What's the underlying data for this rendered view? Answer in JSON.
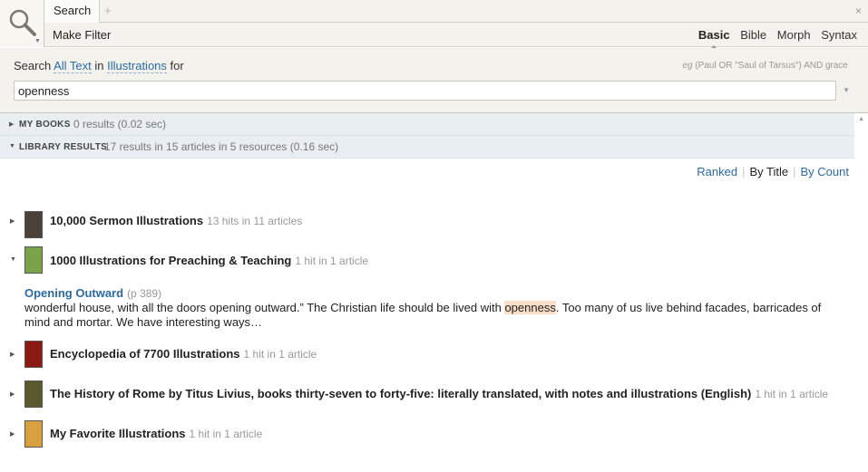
{
  "tab": {
    "label": "Search",
    "add": "+",
    "close": "×"
  },
  "toolbar": {
    "make_filter": "Make Filter",
    "modes": [
      "Basic",
      "Bible",
      "Morph",
      "Syntax"
    ],
    "active_mode": "Basic"
  },
  "query": {
    "prefix": "Search",
    "scope": "All Text",
    "in": "in",
    "collection": "Illustrations",
    "for": "for",
    "hint_eg": "eg",
    "hint_text": "(Paul OR \"Saul of Tarsus\") AND grace",
    "value": "openness"
  },
  "groups": {
    "my_books": {
      "title": "MY BOOKS",
      "summary": "0 results (0.02 sec)"
    },
    "library": {
      "title": "LIBRARY RESULTS",
      "summary": "17 results in 15 articles in 5 resources (0.16 sec)"
    }
  },
  "sort": {
    "ranked": "Ranked",
    "by_title": "By Title",
    "by_count": "By Count",
    "active": "By Title"
  },
  "results": [
    {
      "title": "10,000 Sermon Illustrations",
      "meta": "13 hits in 11 articles",
      "expanded": false,
      "cover_color": "#4a4238"
    },
    {
      "title": "1000 Illustrations for Preaching & Teaching",
      "meta": "1 hit in 1 article",
      "expanded": true,
      "cover_color": "#7aa34a"
    },
    {
      "title": "Encyclopedia of 7700 Illustrations",
      "meta": "1 hit in 1 article",
      "expanded": false,
      "cover_color": "#8b1a12"
    },
    {
      "title": "The History of Rome by Titus Livius, books thirty-seven to forty-five: literally translated, with notes and illustrations (English)",
      "meta": "1 hit in 1 article",
      "expanded": false,
      "cover_color": "#5b5a2e"
    },
    {
      "title": "My Favorite Illustrations",
      "meta": "1 hit in 1 article",
      "expanded": false,
      "cover_color": "#d9a040"
    }
  ],
  "hit": {
    "article": "Opening Outward",
    "page": "(p 389)",
    "before": "wonderful house, with all the doors opening outward.” The Christian life should be lived with ",
    "match": "openness",
    "after": ". Too many of us live behind facades, barricades of mind and mortar. We have interesting ways…"
  }
}
